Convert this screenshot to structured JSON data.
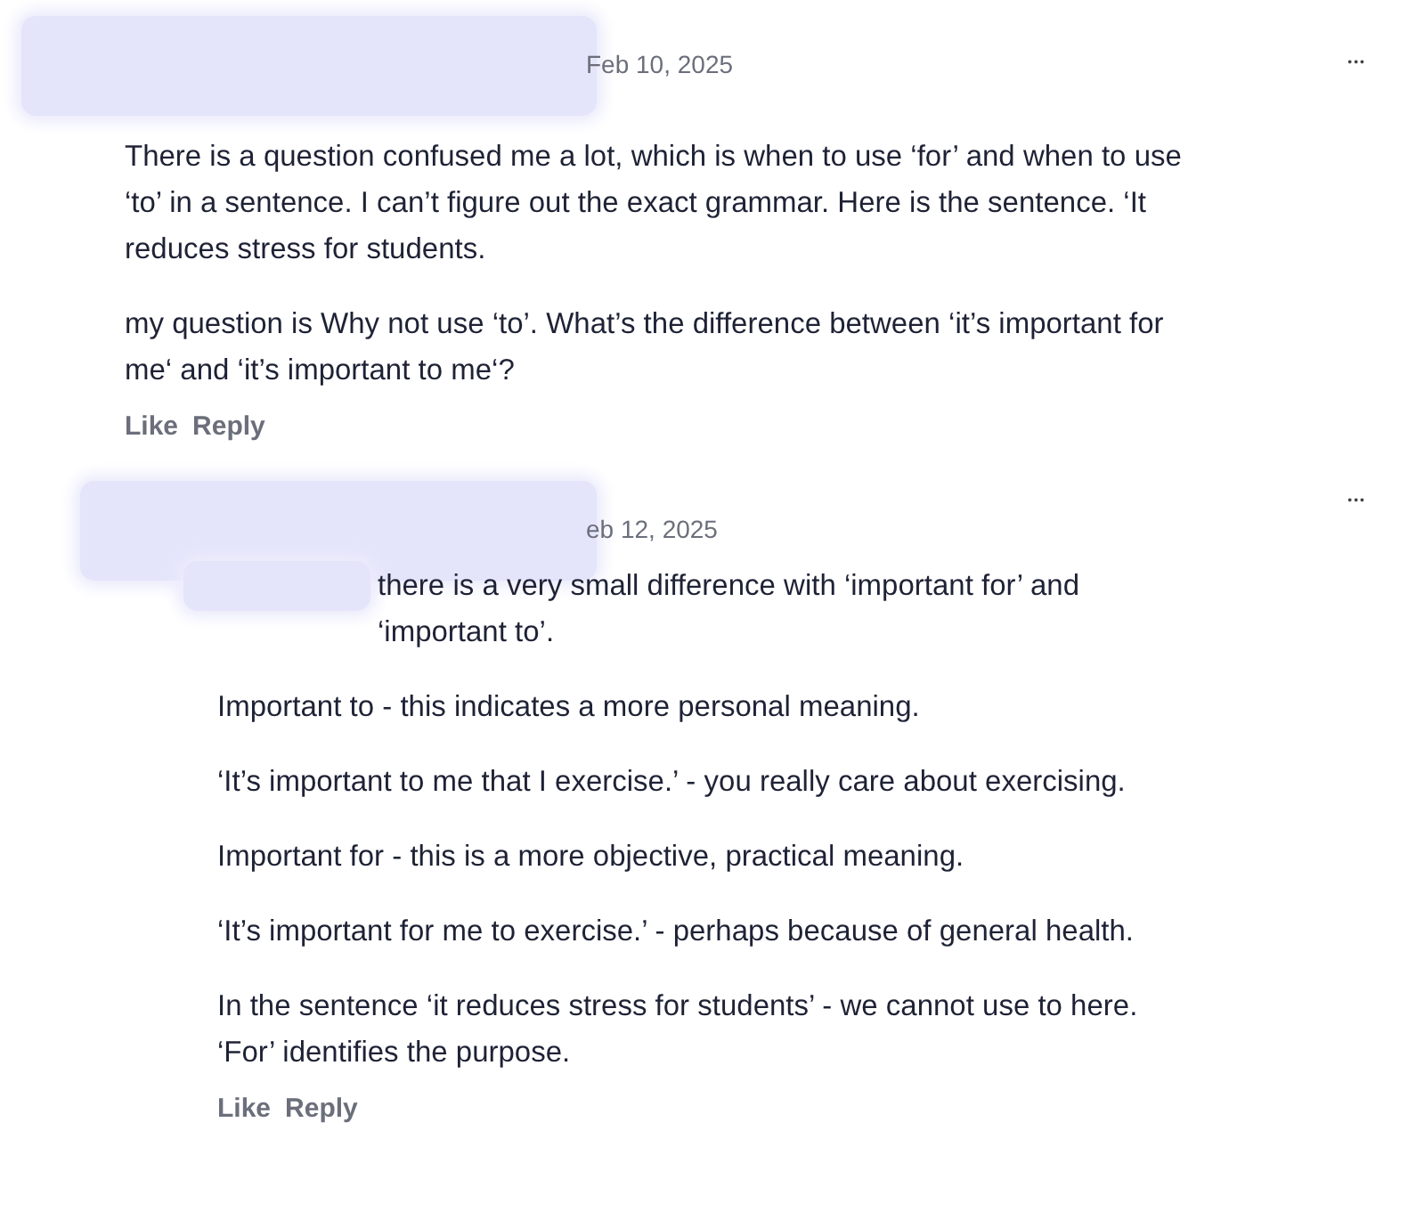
{
  "comments": [
    {
      "kind": "post",
      "date": "Feb 10, 2025",
      "paragraphs": [
        "There is a question confused me a lot, which is when to use ‘for’ and when to use ‘to’ in a sentence. I can’t figure out the exact grammar. Here is the sentence. ‘It reduces stress for students.",
        "my question is Why not use ‘to’. What’s the difference between ‘it’s important for me‘ and ‘it’s important to me‘?"
      ],
      "actions": [
        "Like",
        "Reply"
      ],
      "menu": "•••"
    },
    {
      "kind": "reply",
      "date": "eb 12, 2025",
      "paragraphs": [
        "there is a very small difference with ‘important for’ and ‘important to’.",
        "Important to - this indicates a more personal meaning.",
        "‘It’s important to me that I exercise.’ - you really care about exercising.",
        "Important for - this is a more objective, practical meaning.",
        "‘It’s important for me to exercise.’ - perhaps because of general health.",
        "In the sentence ‘it reduces stress for students’ - we cannot use to here. ‘For’ identifies the purpose."
      ],
      "actions": [
        "Like",
        "Reply"
      ],
      "menu": "•••"
    }
  ]
}
